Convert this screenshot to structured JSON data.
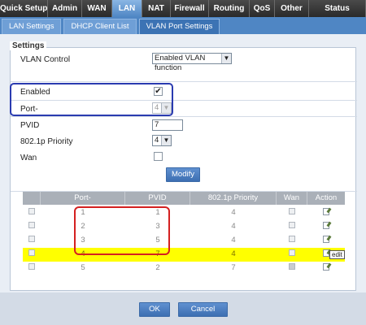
{
  "main_tabs": [
    {
      "label": "Quick Setup",
      "active": false
    },
    {
      "label": "Admin",
      "active": false
    },
    {
      "label": "WAN",
      "active": false
    },
    {
      "label": "LAN",
      "active": true
    },
    {
      "label": "NAT",
      "active": false
    },
    {
      "label": "Firewall",
      "active": false
    },
    {
      "label": "Routing",
      "active": false
    },
    {
      "label": "QoS",
      "active": false
    },
    {
      "label": "Other",
      "active": false
    },
    {
      "label": "Status",
      "active": false
    }
  ],
  "sub_tabs": [
    {
      "label": "LAN Settings",
      "active": false
    },
    {
      "label": "DHCP Client List",
      "active": false
    },
    {
      "label": "VLAN Port Settings",
      "active": true
    }
  ],
  "settings": {
    "legend": "Settings",
    "vlan_control_label": "VLAN Control",
    "vlan_control_value": "Enabled VLAN function",
    "enabled_label": "Enabled",
    "enabled_checked": true,
    "port_label": "Port-",
    "port_value": "4",
    "pvid_label": "PVID",
    "pvid_value": "7",
    "priority_label": "802.1p Priority",
    "priority_value": "4",
    "wan_label": "Wan",
    "wan_checked": false,
    "modify_label": "Modify"
  },
  "table": {
    "headers": [
      "",
      "Port-",
      "PVID",
      "802.1p Priority",
      "Wan",
      "Action"
    ],
    "rows": [
      {
        "port": "1",
        "pvid": "1",
        "priority": "4",
        "wan": false,
        "highlight": false
      },
      {
        "port": "2",
        "pvid": "3",
        "priority": "4",
        "wan": false,
        "highlight": false
      },
      {
        "port": "3",
        "pvid": "5",
        "priority": "4",
        "wan": false,
        "highlight": false
      },
      {
        "port": "4",
        "pvid": "7",
        "priority": "4",
        "wan": false,
        "highlight": true
      },
      {
        "port": "5",
        "pvid": "2",
        "priority": "7",
        "wan": true,
        "highlight": false
      }
    ],
    "tooltip": "edit"
  },
  "buttons": {
    "ok": "OK",
    "cancel": "Cancel"
  },
  "icons": {
    "checkmark": "✔",
    "dropdown": "▼",
    "edit": "edit-icon"
  },
  "colors": {
    "highlight_row": "#ffff00",
    "blue_annotation": "#2a3bb0",
    "red_annotation": "#d42020",
    "accent": "#4f86c4"
  }
}
